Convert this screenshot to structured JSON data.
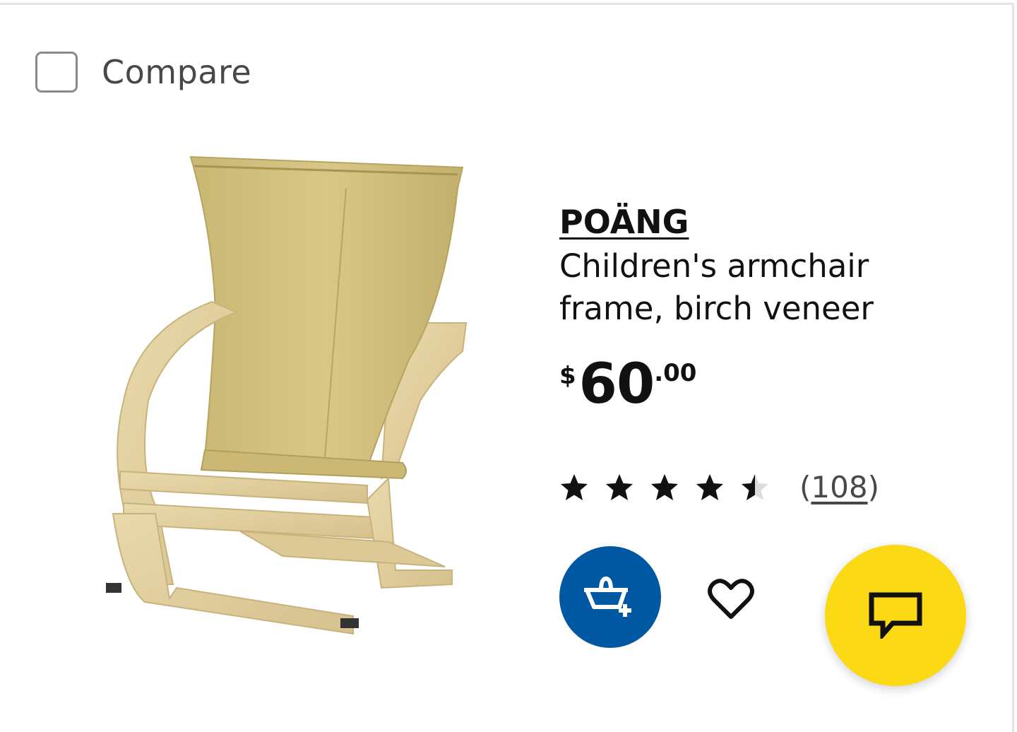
{
  "compare": {
    "label": "Compare",
    "checked": false
  },
  "product": {
    "name": "POÄNG",
    "description_line1": "Children's armchair",
    "description_line2": "frame, birch veneer",
    "price": {
      "currency": "$",
      "integer": "60",
      "decimal": ".00"
    },
    "rating": {
      "value": 4.5,
      "max": 5,
      "review_count_text": "108"
    },
    "image_icon": "armchair-photo"
  },
  "actions": {
    "add_to_cart_icon": "basket-plus-icon",
    "favourite_icon": "heart-outline-icon",
    "chat_icon": "speech-bubble-icon"
  },
  "colors": {
    "cart_blue": "#0058a3",
    "chat_yellow": "#fbd914",
    "text": "#111111",
    "muted": "#484848",
    "border": "#8a8a8a"
  }
}
